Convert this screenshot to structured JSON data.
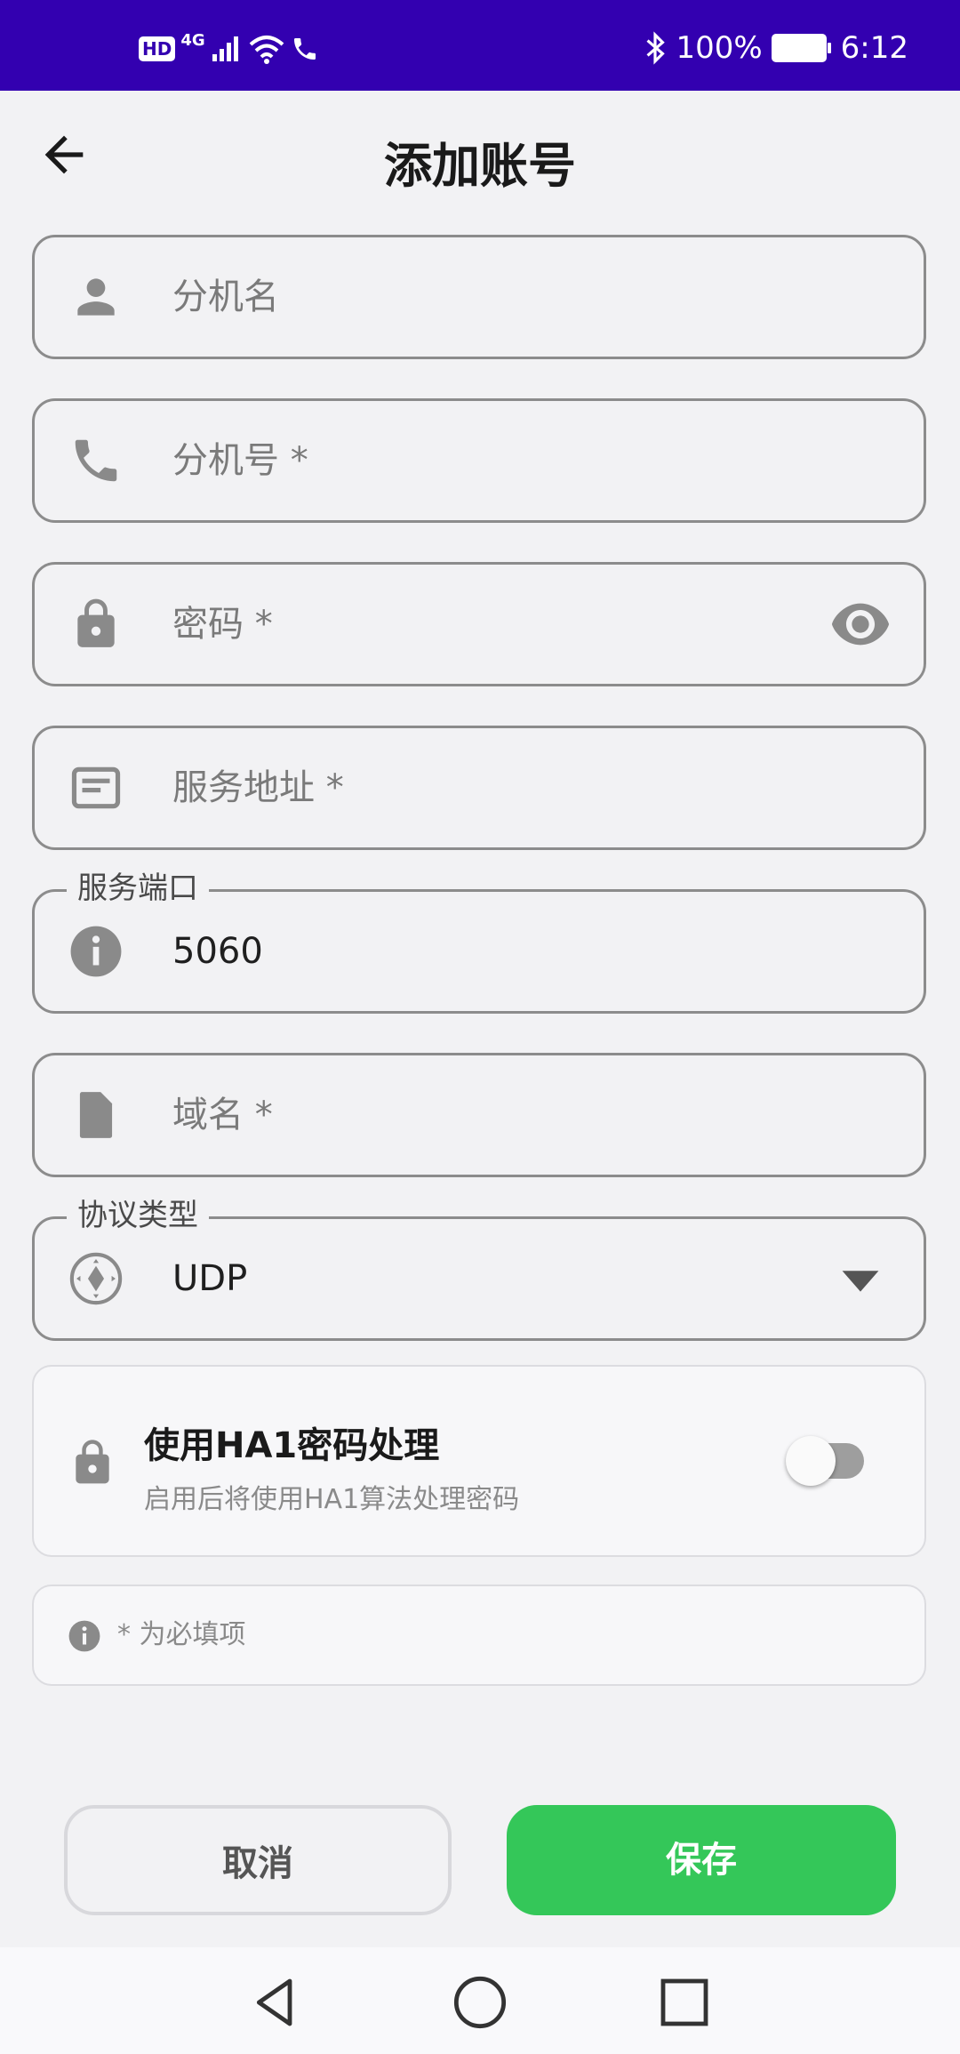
{
  "status_bar": {
    "left_badge": "HD",
    "network": "4G",
    "battery_percent": "100%",
    "time": "6:12"
  },
  "header": {
    "title": "添加账号"
  },
  "fields": {
    "extension_name": {
      "placeholder": "分机名",
      "icon": "person-icon"
    },
    "extension_number": {
      "placeholder": "分机号 *",
      "icon": "phone-icon"
    },
    "password": {
      "placeholder": "密码 *",
      "icon": "lock-icon",
      "trailing_icon": "eye-icon"
    },
    "server_address": {
      "placeholder": "服务地址 *",
      "icon": "server-card-icon"
    },
    "server_port": {
      "label": "服务端口",
      "value": "5060",
      "icon": "info-icon"
    },
    "domain": {
      "placeholder": "域名 *",
      "icon": "sim-card-icon"
    },
    "protocol": {
      "label": "协议类型",
      "value": "UDP",
      "icon": "gamepad-icon",
      "trailing_icon": "dropdown-arrow-icon"
    }
  },
  "ha1_toggle": {
    "title": "使用HA1密码处理",
    "subtitle": "启用后将使用HA1算法处理密码",
    "enabled": false
  },
  "note": {
    "text": "* 为必填项"
  },
  "buttons": {
    "cancel_label": "取消",
    "save_label": "保存"
  },
  "colors": {
    "status_bar": "#3300b0",
    "save_button": "#34c759",
    "icon_gray": "#8a8a8a"
  }
}
